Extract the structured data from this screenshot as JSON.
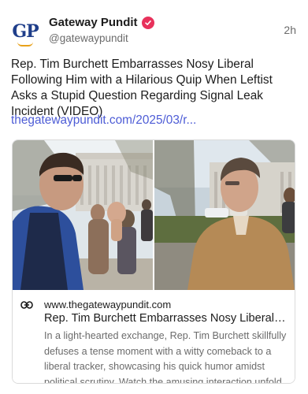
{
  "post": {
    "author": {
      "display_name": "Gateway Pundit",
      "handle": "@gatewaypundit",
      "avatar_text": "GP",
      "verified_icon": "checkmark-badge-icon"
    },
    "timestamp": "2h",
    "text": "Rep. Tim Burchett Embarrasses Nosy Liberal Following Him with a Hilarious Quip When Leftist Asks a Stupid Question Regarding Signal Leak Incident (VIDEO)",
    "link_text": "thegatewaypundit.com/2025/03/r..."
  },
  "link_card": {
    "icon": "link-icon",
    "domain": "www.thegatewaypundit.com",
    "title": "Rep. Tim Burchett Embarrasses Nosy Liberal F...",
    "description": "In a light-hearted exchange, Rep. Tim Burchett skillfully defuses a tense moment with a witty comeback to a liberal tracker, showcasing his quick humor amidst political scrutiny. Watch the amusing interaction unfold."
  },
  "colors": {
    "accent_link": "#4d5cd6",
    "verified_badge": "#e8315b",
    "avatar_blue": "#1f3e8a",
    "avatar_gold": "#e8a11a",
    "muted_text": "#6b6b6b"
  }
}
